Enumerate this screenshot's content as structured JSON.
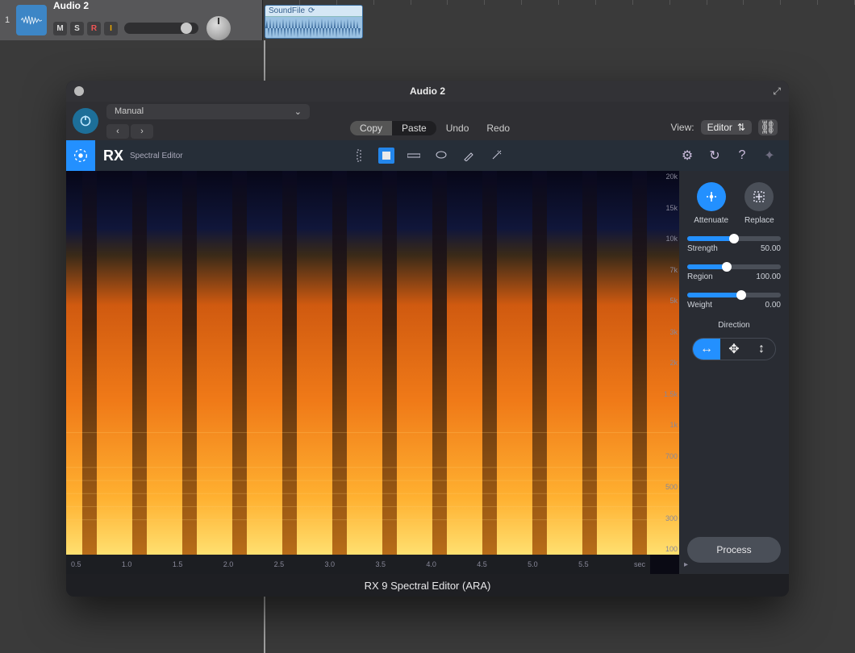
{
  "track": {
    "number": "1",
    "name": "Audio 2",
    "buttons": {
      "mute": "M",
      "solo": "S",
      "rec": "R",
      "input": "I"
    }
  },
  "region": {
    "name": "SoundFile",
    "loop_icon": "loop-icon"
  },
  "plugin": {
    "title": "Audio 2",
    "dropdown": "Manual",
    "copy": "Copy",
    "paste": "Paste",
    "undo": "Undo",
    "redo": "Redo",
    "view_label": "View:",
    "view_value": "Editor",
    "rx_brand": "RX",
    "rx_sub": "Spectral Editor",
    "footer": "RX 9 Spectral Editor (ARA)"
  },
  "freq_ticks": [
    "20k",
    "15k",
    "10k",
    "7k",
    "5k",
    "3k",
    "2k",
    "1.5k",
    "1k",
    "700",
    "500",
    "300",
    "100"
  ],
  "time_ticks": [
    "0.5",
    "1.0",
    "1.5",
    "2.0",
    "2.5",
    "3.0",
    "3.5",
    "4.0",
    "4.5",
    "5.0",
    "5.5",
    "sec"
  ],
  "side": {
    "attenuate": "Attenuate",
    "replace": "Replace",
    "strength": {
      "label": "Strength",
      "value": "50.00",
      "pct": 50
    },
    "region": {
      "label": "Region",
      "value": "100.00",
      "pct": 42
    },
    "weight": {
      "label": "Weight",
      "value": "0.00",
      "pct": 58
    },
    "direction": "Direction",
    "process": "Process"
  }
}
